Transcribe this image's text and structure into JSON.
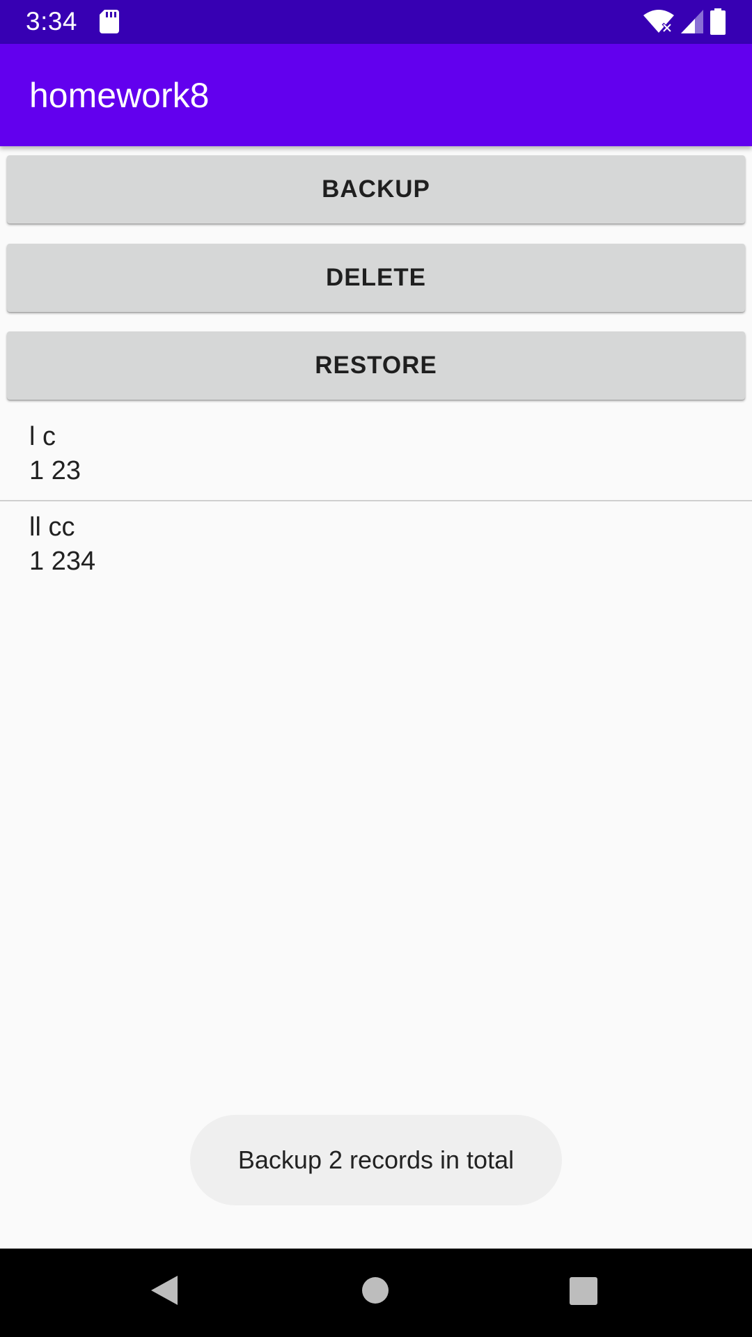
{
  "status_bar": {
    "time": "3:34",
    "icons": [
      "sd-card-icon",
      "wifi-icon",
      "signal-icon",
      "battery-icon"
    ]
  },
  "app_bar": {
    "title": "homework8"
  },
  "buttons": {
    "backup": "BACKUP",
    "delete": "DELETE",
    "restore": "RESTORE"
  },
  "records": [
    {
      "line1": "l c",
      "line2": "1 23"
    },
    {
      "line1": "ll cc",
      "line2": "1 234"
    }
  ],
  "toast": {
    "message": "Backup 2 records in total"
  },
  "nav_bar": {
    "icons": [
      "back-icon",
      "home-icon",
      "recents-icon"
    ]
  },
  "colors": {
    "status_bar": "#3700b3",
    "app_bar": "#6200ee",
    "button": "#d6d7d7",
    "background": "#fafafa"
  }
}
